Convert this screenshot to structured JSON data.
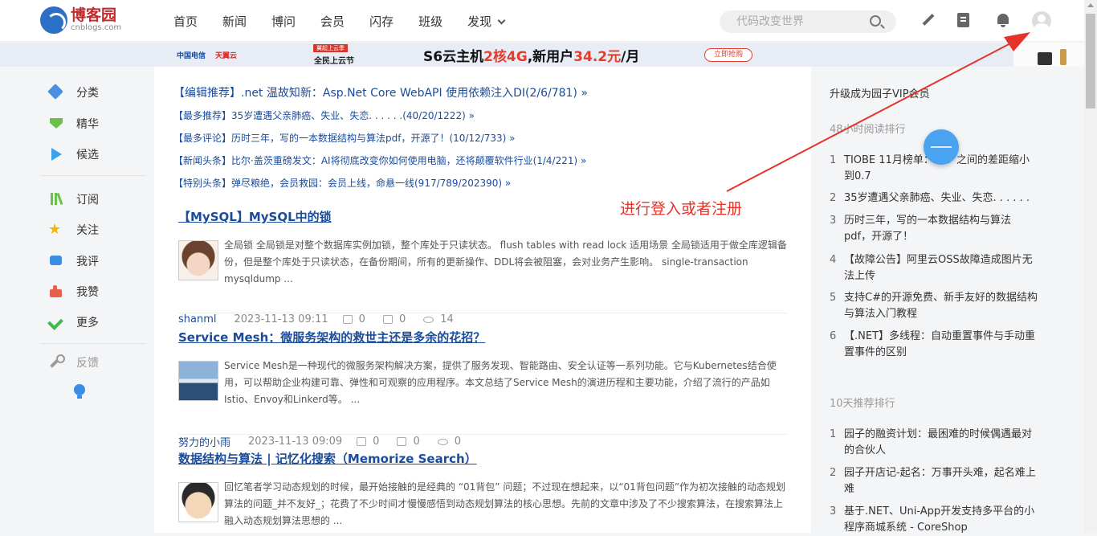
{
  "header": {
    "logo_name": "博客园",
    "logo_sub": "cnblogs.com",
    "nav": [
      "首页",
      "新闻",
      "博问",
      "会员",
      "闪存",
      "班级",
      "发现"
    ],
    "search_placeholder": "代码改变世界"
  },
  "banner": {
    "logo1": "中国电信",
    "logo2": "天翼云",
    "badge": "翼起上云季",
    "sub": "全民上云节",
    "main_a": "S6云主机",
    "main_b": "2核4G",
    "main_c": ",新用户",
    "main_d": "34.2元",
    "main_e": "/月",
    "cta": "立即抢购"
  },
  "sidebar": {
    "items": [
      "分类",
      "精华",
      "候选",
      "订阅",
      "关注",
      "我评",
      "我赞",
      "更多"
    ],
    "feedback": "反馈"
  },
  "headlines": [
    "【编辑推荐】.net 温故知新：Asp.Net Core WebAPI 使用依赖注入DI(2/6/781) »",
    "【最多推荐】35岁遭遇父亲肺癌、失业、失恋. . . . . .(40/20/1222) »",
    "【最多评论】历时三年，写的一本数据结构与算法pdf，开源了！(10/12/733) »",
    "【新闻头条】比尔·盖茨重磅发文：AI将彻底改变你如何使用电脑，还将颠覆软件行业(1/4/221) »",
    "【特别头条】弹尽粮绝，会员救园：会员上线，命悬一线(917/789/202390) »"
  ],
  "posts": [
    {
      "title": "【MySQL】MySQL中的锁",
      "summary": "全局锁 全局锁是对整个数据库实例加锁，整个库处于只读状态。 flush tables with read lock 适用场景 全局锁适用于做全库逻辑备份，但是整个库处于只读状态，在备份期间，所有的更新操作、DDL将会被阻塞，会对业务产生影响。 single-transaction mysqldump ...",
      "author": "shanml",
      "date": "2023-11-13 09:11",
      "likes": "0",
      "comments": "0",
      "views": "14"
    },
    {
      "title": "Service Mesh：微服务架构的救世主还是多余的花招？",
      "summary": "Service Mesh是一种现代的微服务架构解决方案，提供了服务发现、智能路由、安全认证等一系列功能。它与Kubernetes结合使用，可以帮助企业构建可靠、弹性和可观察的应用程序。本文总结了Service Mesh的演进历程和主要功能，介绍了流行的产品如Istio、Envoy和Linkerd等。 ...",
      "author": "努力的小雨",
      "date": "2023-11-13 09:09",
      "likes": "0",
      "comments": "0",
      "views": "0"
    },
    {
      "title": "数据结构与算法 | 记忆化搜索（Memorize Search）",
      "summary": "回忆笔者学习动态规划的时候，最开始接触的是经典的 “01背包” 问题；不过现在想起来，以“01背包问题”作为初次接触的动态规划算法的问题_并不友好_；花费了不少时间才慢慢感悟到动态规划算法的核心思想。先前的文章中涉及了不少搜索算法，在搜索算法上融入动态规划算法思想的 ...",
      "author": "",
      "date": "",
      "likes": "",
      "comments": "",
      "views": ""
    }
  ],
  "right": {
    "vip": "升级成为园子VIP会员",
    "read48_title": "48小时阅读排行",
    "read48": [
      {
        "n": "1",
        "t": "TIOBE 11月榜单：        C# 之间的差距缩小到0.7"
      },
      {
        "n": "2",
        "t": "35岁遭遇父亲肺癌、失业、失恋. . . . . ."
      },
      {
        "n": "3",
        "t": "历时三年，写的一本数据结构与算法pdf，开源了！"
      },
      {
        "n": "4",
        "t": "【故障公告】阿里云OSS故障造成图片无法上传"
      },
      {
        "n": "5",
        "t": "支持C#的开源免费、新手友好的数据结构与算法入门教程"
      },
      {
        "n": "6",
        "t": "【.NET】多线程：自动重置事件与手动重置事件的区别"
      }
    ],
    "rec10_title": "10天推荐排行",
    "rec10": [
      {
        "n": "1",
        "t": "园子的融资计划：最困难的时候偶遇最对的合伙人"
      },
      {
        "n": "2",
        "t": "园子开店记-起名：万事开头难，起名难上难"
      },
      {
        "n": "3",
        "t": "基于.NET、Uni-App开发支持多平台的小程序商城系统 - CoreShop"
      }
    ]
  },
  "annotation": "进行登入或者注册",
  "colors": {
    "link": "#1b4c9c",
    "annotation": "#e5332a",
    "background": "#f4f5f7"
  }
}
